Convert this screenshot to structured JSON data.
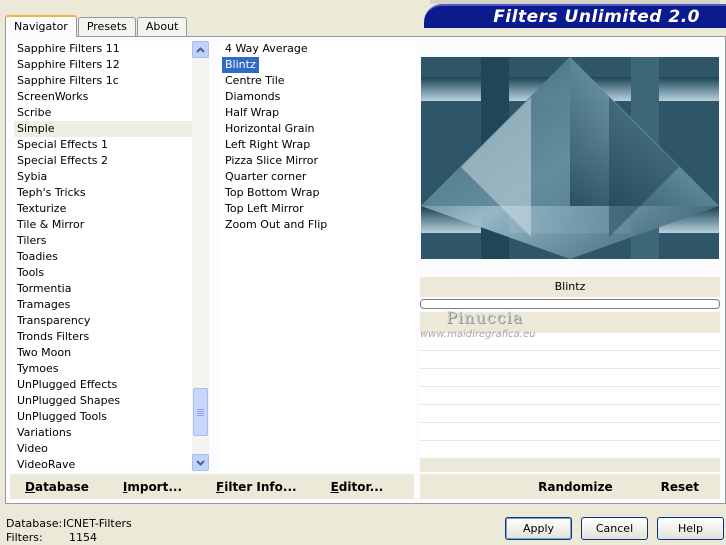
{
  "tabs": [
    {
      "label": "Navigator",
      "active": true
    },
    {
      "label": "Presets",
      "active": false
    },
    {
      "label": "About",
      "active": false
    }
  ],
  "banner": {
    "title": "Filters Unlimited 2.0"
  },
  "categories": [
    "Sapphire Filters 11",
    "Sapphire Filters 12",
    "Sapphire Filters 1c",
    "ScreenWorks",
    "Scribe",
    "Simple",
    "Special Effects 1",
    "Special Effects 2",
    "Sybia",
    "Teph's Tricks",
    "Texturize",
    "Tile & Mirror",
    "Tilers",
    "Toadies",
    "Tools",
    "Tormentia",
    "Tramages",
    "Transparency",
    "Tronds Filters",
    "Two Moon",
    "Tymoes",
    "UnPlugged Effects",
    "UnPlugged Shapes",
    "UnPlugged Tools",
    "Variations",
    "Video",
    "VideoRave"
  ],
  "highlighted_category": "Simple",
  "filters": [
    "4 Way Average",
    "Blintz",
    "Centre Tile",
    "Diamonds",
    "Half Wrap",
    "Horizontal Grain",
    "Left Right Wrap",
    "Pizza Slice Mirror",
    "Quarter corner",
    "Top Bottom Wrap",
    "Top Left Mirror",
    "Zoom Out and Flip"
  ],
  "selected_filter": "Blintz",
  "preview": {
    "filter_name": "Blintz",
    "progress": 0
  },
  "watermark": {
    "name": "Pinuccia",
    "url": "www.maidiregrafica.eu"
  },
  "bottom_bar_left": [
    {
      "label": "Database",
      "mnemonic": "D"
    },
    {
      "label": "Import...",
      "mnemonic": "I"
    },
    {
      "label": "Filter Info...",
      "mnemonic": "F"
    },
    {
      "label": "Editor...",
      "mnemonic": "E"
    }
  ],
  "bottom_bar_right": [
    {
      "label": "Randomize"
    },
    {
      "label": "Reset"
    }
  ],
  "footer": {
    "database_label": "Database:",
    "database_value": "ICNET-Filters",
    "filters_label": "Filters:",
    "filters_value": "1154"
  },
  "buttons": {
    "apply": "Apply",
    "cancel": "Cancel",
    "help": "Help"
  },
  "colors": {
    "selection": "#316ac5",
    "banner": "#0b1a8c",
    "preview_base": "#33596a"
  }
}
